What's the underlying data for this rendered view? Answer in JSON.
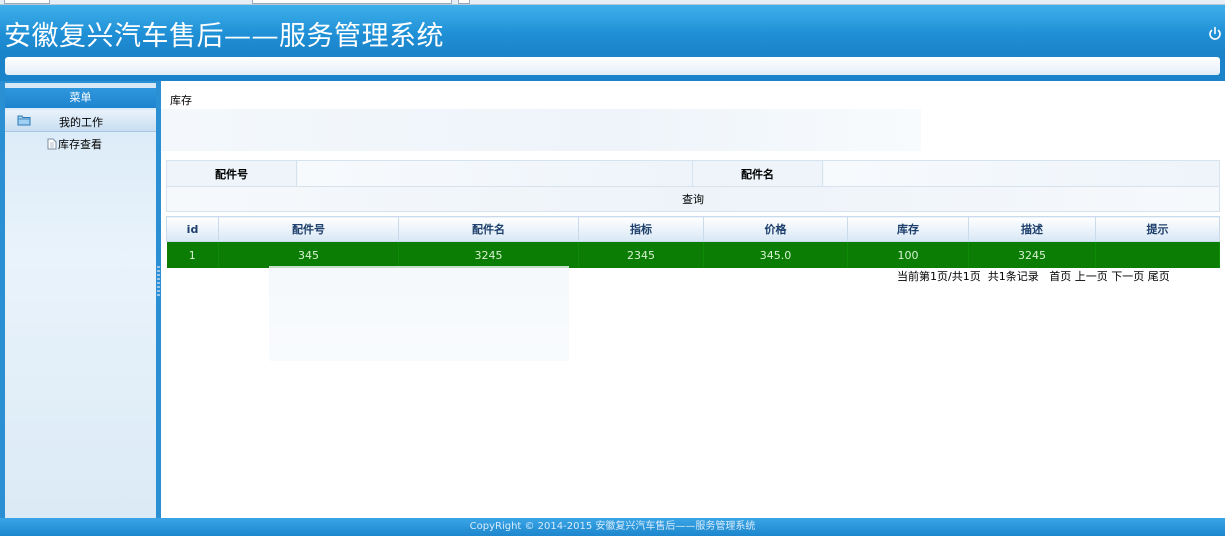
{
  "header": {
    "title": "安徽复兴汽车售后——服务管理系统",
    "power_icon": "power-icon"
  },
  "sidebar": {
    "heading": "菜单",
    "group_label": "我的工作",
    "group_icon": "folder-icon",
    "items": [
      {
        "label": "库存查看",
        "icon": "document-icon"
      }
    ]
  },
  "main": {
    "breadcrumb": "库存",
    "search": {
      "part_no_label": "配件号",
      "part_no_value": "",
      "part_name_label": "配件名",
      "part_name_value": "",
      "query_label": "查询"
    },
    "table": {
      "columns": [
        "id",
        "配件号",
        "配件名",
        "指标",
        "价格",
        "库存",
        "描述",
        "提示"
      ],
      "rows": [
        [
          "1",
          "345",
          "3245",
          "2345",
          "345.0",
          "100",
          "3245",
          ""
        ]
      ],
      "row_highlight_color": "#0b7d04"
    },
    "pager": {
      "status": "当前第1页/共1页",
      "total": "共1条记录",
      "first": "首页",
      "prev": "上一页",
      "next": "下一页",
      "last": "尾页"
    }
  },
  "footer": {
    "copyright": "CopyRight © 2014-2015 安徽复兴汽车售后——服务管理系统"
  },
  "colors": {
    "header_blue": "#1f8fd6",
    "sidebar_blue": "#2b8fd3"
  }
}
